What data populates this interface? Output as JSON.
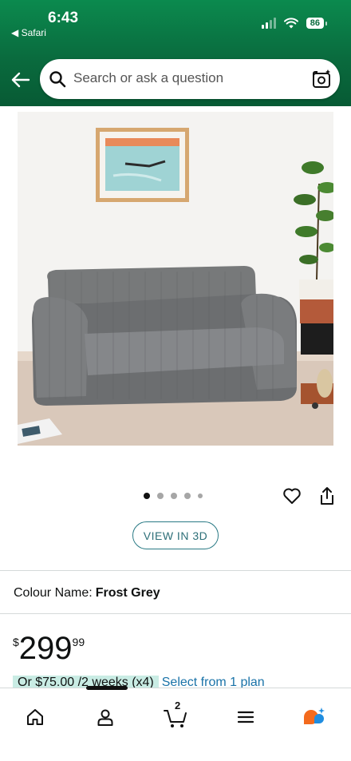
{
  "status_bar": {
    "time": "6:43",
    "back_app": "Safari",
    "battery": "86"
  },
  "search": {
    "placeholder": "Search or ask a question"
  },
  "view3d_label": "VIEW IN 3D",
  "colour": {
    "label": "Colour Name:",
    "value": "Frost Grey"
  },
  "price": {
    "currency": "$",
    "whole": "299",
    "fraction": "99"
  },
  "installment": {
    "text": "Or $75.00 /2 weeks (x4)",
    "link": "Select from 1 plan"
  },
  "tabbar": {
    "cart_count": "2"
  },
  "colors": {
    "header": "#0a6b3e",
    "link": "#1a73a8",
    "view3d_border": "#2a7a85",
    "installment_bg": "#c9ece4"
  }
}
